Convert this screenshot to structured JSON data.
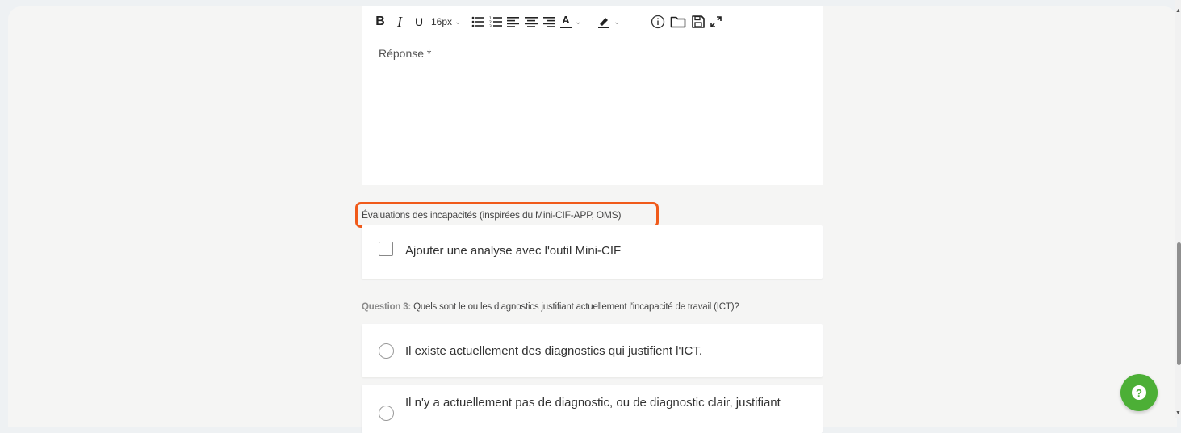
{
  "toolbar": {
    "bold": "B",
    "italic": "I",
    "underline": "U",
    "font_size": "16px",
    "text_color_letter": "A",
    "icons": [
      "bold-icon",
      "italic-icon",
      "underline-icon",
      "font-size-select",
      "bullet-list-icon",
      "numbered-list-icon",
      "align-left-icon",
      "align-center-icon",
      "align-right-icon",
      "text-color-icon",
      "highlight-color-icon",
      "info-icon",
      "folder-icon",
      "save-icon",
      "expand-icon"
    ]
  },
  "editor": {
    "placeholder": "Réponse *"
  },
  "section": {
    "title": "Évaluations des incapacités (inspirées du Mini-CIF-APP, OMS)",
    "checkbox_label": "Ajouter une analyse avec l'outil Mini-CIF",
    "checked": false
  },
  "question3": {
    "number": "Question 3:",
    "text": "Quels sont le ou les diagnostics justifiant actuellement l'incapacité de travail (ICT)?",
    "options": [
      "Il existe actuellement des diagnostics qui justifient l'ICT.",
      "Il n'y a actuellement pas de diagnostic, ou de diagnostic clair, justifiant"
    ]
  },
  "help": {
    "label": "?"
  },
  "colors": {
    "accent_highlight": "#f05a1a",
    "help_button": "#4caf36",
    "background": "#f5f5f4"
  },
  "scrollbar": {
    "position_fraction": 0.6
  }
}
